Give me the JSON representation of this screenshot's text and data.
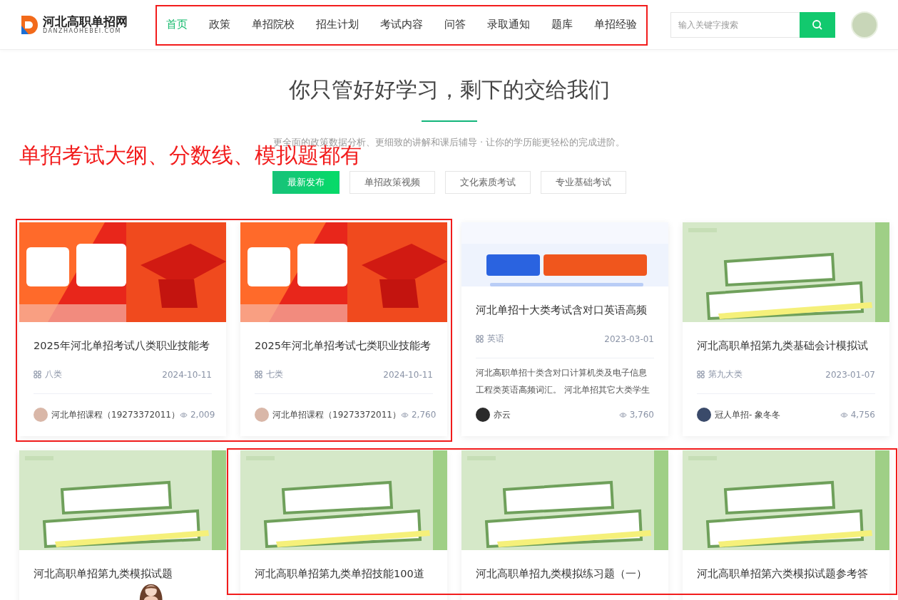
{
  "header": {
    "logo": {
      "name": "河北高职单招网",
      "domain": "DANZHAOHEBEI.COM"
    },
    "nav": [
      {
        "label": "首页",
        "selected": true
      },
      {
        "label": "政策",
        "selected": false
      },
      {
        "label": "单招院校",
        "selected": false
      },
      {
        "label": "招生计划",
        "selected": false
      },
      {
        "label": "考试内容",
        "selected": false
      },
      {
        "label": "问答",
        "selected": false
      },
      {
        "label": "录取通知",
        "selected": false
      },
      {
        "label": "题库",
        "selected": false
      },
      {
        "label": "单招经验",
        "selected": false
      }
    ],
    "search": {
      "placeholder": "输入关键字搜索"
    }
  },
  "hero": {
    "title": "你只管好好学习，剩下的交给我们",
    "subtitle": "更全面的政策数据分析、更细致的讲解和课后辅导 · 让你的学历能更轻松的完成进阶。"
  },
  "annotation": "单招考试大纲、分数线、模拟题都有",
  "tabs": [
    {
      "label": "最新发布",
      "selected": true
    },
    {
      "label": "单招政策视频",
      "selected": false
    },
    {
      "label": "文化素质考试",
      "selected": false
    },
    {
      "label": "专业基础考试",
      "selected": false
    }
  ],
  "cards": [
    {
      "kind": "outline",
      "title": "2025年河北单招考试八类职业技能考",
      "tag": "八类",
      "date": "2024-10-11",
      "author": "河北单招课程（19273372011）",
      "views": "2,009"
    },
    {
      "kind": "outline",
      "title": "2025年河北单招考试七类职业技能考",
      "tag": "七类",
      "date": "2024-10-11",
      "author": "河北单招课程（19273372011）",
      "views": "2,760"
    },
    {
      "kind": "vocab",
      "title": "河北单招十大类考试含对口英语高频",
      "tag": "英语",
      "date": "2023-03-01",
      "excerpt": "河北高职单招十类含对口计算机类及电子信息工程类英语高频词汇。 河北单招其它大类学生",
      "author": "亦云",
      "views": "3,760"
    },
    {
      "kind": "quiz",
      "title": "河北高职单招第九类基础会计模拟试",
      "tag": "第九大类",
      "date": "2023-01-07",
      "author": "冠人单招- 象冬冬",
      "views": "4,756"
    },
    {
      "kind": "quiz",
      "title": "河北高职单招第九类模拟试题"
    },
    {
      "kind": "quiz",
      "title": "河北高职单招第九类单招技能100道"
    },
    {
      "kind": "quiz",
      "title": "河北高职单招九类模拟练习题（一）"
    },
    {
      "kind": "quiz",
      "title": "河北高职单招第六类模拟试题参考答"
    }
  ]
}
